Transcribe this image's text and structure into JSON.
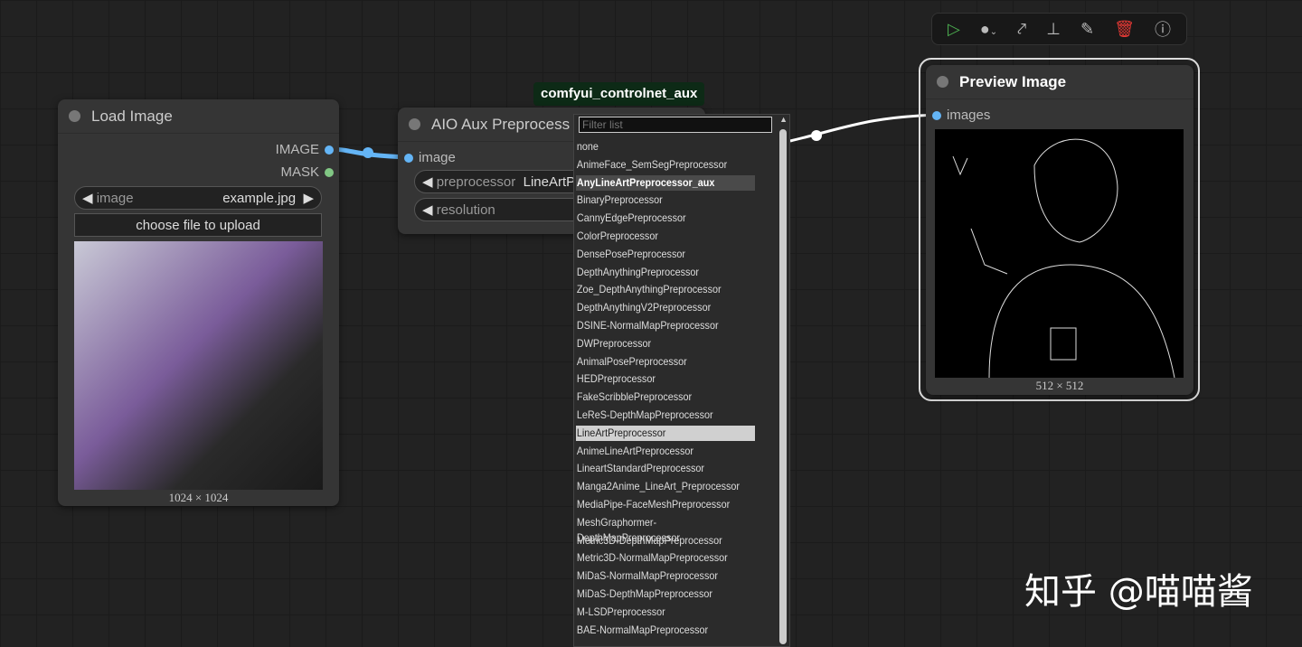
{
  "load_image": {
    "title": "Load Image",
    "outputs": [
      "IMAGE",
      "MASK"
    ],
    "image_widget_label": "image",
    "image_widget_value": "example.jpg",
    "upload_label": "choose file to upload",
    "size": "1024 × 1024"
  },
  "aio": {
    "title": "AIO Aux Preprocess",
    "badge": "comfyui_controlnet_aux",
    "input": "image",
    "preprocessor_label": "preprocessor",
    "preprocessor_value": "LineArtP",
    "resolution_label": "resolution"
  },
  "dropdown": {
    "placeholder": "Filter list",
    "hover": "AnyLineArtPreprocessor_aux",
    "selected": "LineArtPreprocessor",
    "items": [
      "none",
      "AnimeFace_SemSegPreprocessor",
      "AnyLineArtPreprocessor_aux",
      "BinaryPreprocessor",
      "CannyEdgePreprocessor",
      "ColorPreprocessor",
      "DensePosePreprocessor",
      "DepthAnythingPreprocessor",
      "Zoe_DepthAnythingPreprocessor",
      "DepthAnythingV2Preprocessor",
      "DSINE-NormalMapPreprocessor",
      "DWPreprocessor",
      "AnimalPosePreprocessor",
      "HEDPreprocessor",
      "FakeScribblePreprocessor",
      "LeReS-DepthMapPreprocessor",
      "LineArtPreprocessor",
      "AnimeLineArtPreprocessor",
      "LineartStandardPreprocessor",
      "Manga2Anime_LineArt_Preprocessor",
      "MediaPipe-FaceMeshPreprocessor",
      "MeshGraphormer-DepthMapPreprocessor",
      "Metric3D-DepthMapPreprocessor",
      "Metric3D-NormalMapPreprocessor",
      "MiDaS-NormalMapPreprocessor",
      "MiDaS-DepthMapPreprocessor",
      "M-LSDPreprocessor",
      "BAE-NormalMapPreprocessor"
    ]
  },
  "preview": {
    "title": "Preview Image",
    "input": "images",
    "size": "512 × 512"
  },
  "toolbar": {
    "icons": [
      "play-icon",
      "color-icon",
      "bypass-icon",
      "pin-icon",
      "edit-icon",
      "trash-icon",
      "help-icon"
    ]
  },
  "watermark": "知乎 @喵喵酱",
  "colors": {
    "image_link": "#64b5f6",
    "mask_slot": "#81c784",
    "run": "#4caf50",
    "delete": "#e53935"
  }
}
